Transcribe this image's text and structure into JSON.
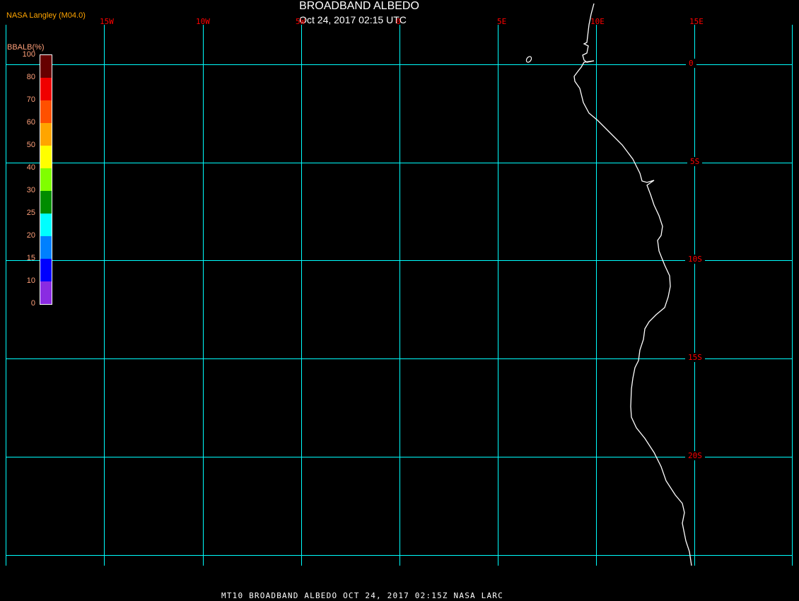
{
  "title": "BROADBAND ALBEDO",
  "subtitle": "Oct 24, 2017 02:15 UTC",
  "org": "NASA Langley (M04.0)",
  "footer": "MT10  BROADBAND ALBEDO   OCT 24, 2017 02:15Z   NASA LARC",
  "grid_color": "#00ffff",
  "coast_color": "#ffffff",
  "lon_labels": [
    "15W",
    "10W",
    "5W",
    "0",
    "5E",
    "10E",
    "15E"
  ],
  "lat_labels": [
    "0",
    "5S",
    "10S",
    "15S",
    "20S"
  ],
  "colorbar": {
    "title": "BBALB(%)",
    "labels": [
      "100",
      "80",
      "70",
      "60",
      "50",
      "40",
      "30",
      "25",
      "20",
      "15",
      "10",
      "0"
    ],
    "colors": [
      "#660000",
      "#f00000",
      "#ff5000",
      "#ffa500",
      "#ffff00",
      "#80ff00",
      "#008c00",
      "#00ffff",
      "#0080ff",
      "#0000ff",
      "#8a2be2"
    ]
  }
}
